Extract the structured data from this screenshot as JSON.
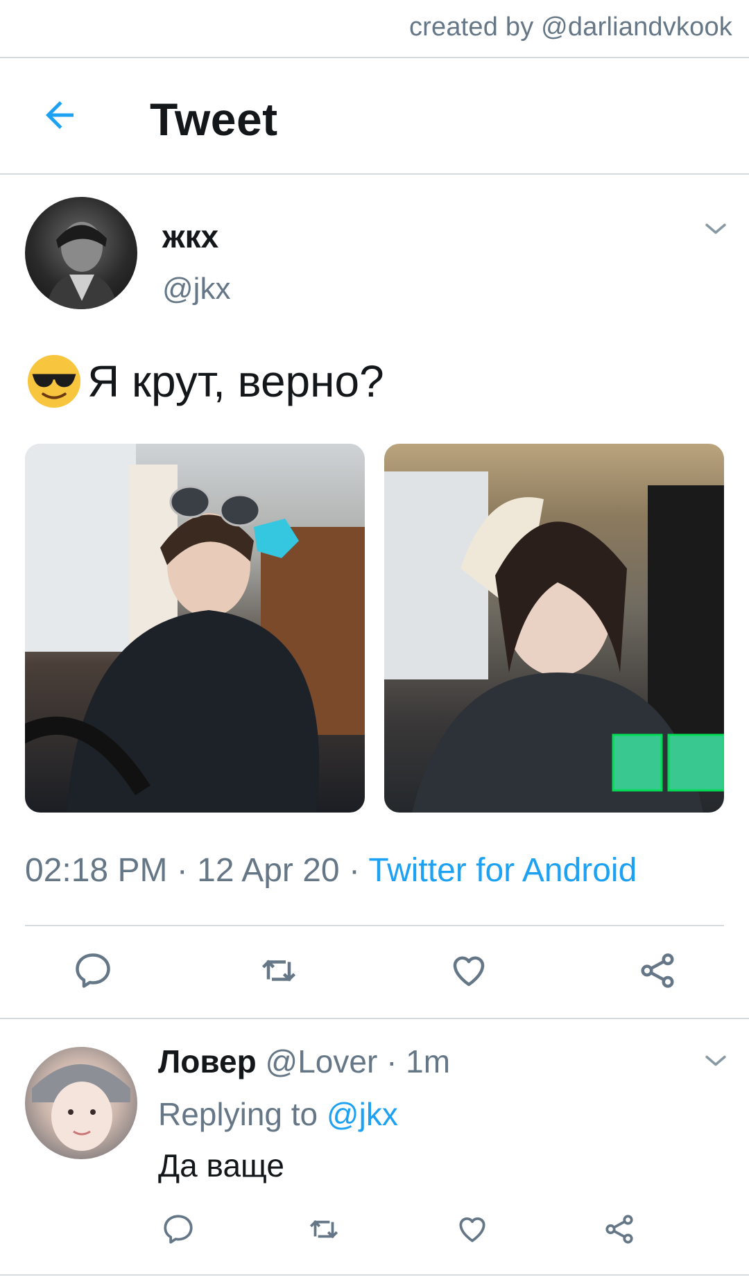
{
  "credit": "created by @darliandvkook",
  "header": {
    "title": "Tweet"
  },
  "tweet": {
    "display_name": "жкх",
    "handle": "@jkx",
    "text": "Я крут, верно?",
    "time": "02:18 PM",
    "date": "12 Apr 20",
    "source": "Twitter for Android",
    "separator": "·"
  },
  "reply": {
    "display_name": "Ловер",
    "handle": "@Lover",
    "age": "1m",
    "replying_prefix": "Replying to",
    "replying_to": "@jkx",
    "text": "Да ваще"
  },
  "colors": {
    "accent": "#1da1f2",
    "muted": "#657786",
    "divider": "#d6dbe0"
  },
  "icons": [
    "back-arrow-icon",
    "chevron-down-icon",
    "reply-icon",
    "retweet-icon",
    "like-icon",
    "share-icon",
    "sunglasses-emoji"
  ]
}
